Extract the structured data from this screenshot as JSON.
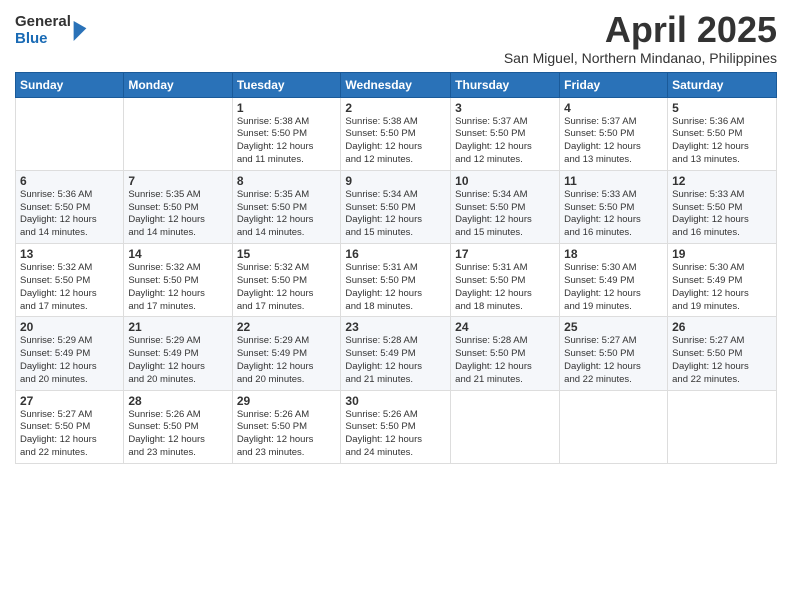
{
  "logo": {
    "general": "General",
    "blue": "Blue"
  },
  "title": "April 2025",
  "subtitle": "San Miguel, Northern Mindanao, Philippines",
  "weekdays": [
    "Sunday",
    "Monday",
    "Tuesday",
    "Wednesday",
    "Thursday",
    "Friday",
    "Saturday"
  ],
  "weeks": [
    [
      {
        "day": "",
        "info": ""
      },
      {
        "day": "",
        "info": ""
      },
      {
        "day": "1",
        "info": "Sunrise: 5:38 AM\nSunset: 5:50 PM\nDaylight: 12 hours\nand 11 minutes."
      },
      {
        "day": "2",
        "info": "Sunrise: 5:38 AM\nSunset: 5:50 PM\nDaylight: 12 hours\nand 12 minutes."
      },
      {
        "day": "3",
        "info": "Sunrise: 5:37 AM\nSunset: 5:50 PM\nDaylight: 12 hours\nand 12 minutes."
      },
      {
        "day": "4",
        "info": "Sunrise: 5:37 AM\nSunset: 5:50 PM\nDaylight: 12 hours\nand 13 minutes."
      },
      {
        "day": "5",
        "info": "Sunrise: 5:36 AM\nSunset: 5:50 PM\nDaylight: 12 hours\nand 13 minutes."
      }
    ],
    [
      {
        "day": "6",
        "info": "Sunrise: 5:36 AM\nSunset: 5:50 PM\nDaylight: 12 hours\nand 14 minutes."
      },
      {
        "day": "7",
        "info": "Sunrise: 5:35 AM\nSunset: 5:50 PM\nDaylight: 12 hours\nand 14 minutes."
      },
      {
        "day": "8",
        "info": "Sunrise: 5:35 AM\nSunset: 5:50 PM\nDaylight: 12 hours\nand 14 minutes."
      },
      {
        "day": "9",
        "info": "Sunrise: 5:34 AM\nSunset: 5:50 PM\nDaylight: 12 hours\nand 15 minutes."
      },
      {
        "day": "10",
        "info": "Sunrise: 5:34 AM\nSunset: 5:50 PM\nDaylight: 12 hours\nand 15 minutes."
      },
      {
        "day": "11",
        "info": "Sunrise: 5:33 AM\nSunset: 5:50 PM\nDaylight: 12 hours\nand 16 minutes."
      },
      {
        "day": "12",
        "info": "Sunrise: 5:33 AM\nSunset: 5:50 PM\nDaylight: 12 hours\nand 16 minutes."
      }
    ],
    [
      {
        "day": "13",
        "info": "Sunrise: 5:32 AM\nSunset: 5:50 PM\nDaylight: 12 hours\nand 17 minutes."
      },
      {
        "day": "14",
        "info": "Sunrise: 5:32 AM\nSunset: 5:50 PM\nDaylight: 12 hours\nand 17 minutes."
      },
      {
        "day": "15",
        "info": "Sunrise: 5:32 AM\nSunset: 5:50 PM\nDaylight: 12 hours\nand 17 minutes."
      },
      {
        "day": "16",
        "info": "Sunrise: 5:31 AM\nSunset: 5:50 PM\nDaylight: 12 hours\nand 18 minutes."
      },
      {
        "day": "17",
        "info": "Sunrise: 5:31 AM\nSunset: 5:50 PM\nDaylight: 12 hours\nand 18 minutes."
      },
      {
        "day": "18",
        "info": "Sunrise: 5:30 AM\nSunset: 5:49 PM\nDaylight: 12 hours\nand 19 minutes."
      },
      {
        "day": "19",
        "info": "Sunrise: 5:30 AM\nSunset: 5:49 PM\nDaylight: 12 hours\nand 19 minutes."
      }
    ],
    [
      {
        "day": "20",
        "info": "Sunrise: 5:29 AM\nSunset: 5:49 PM\nDaylight: 12 hours\nand 20 minutes."
      },
      {
        "day": "21",
        "info": "Sunrise: 5:29 AM\nSunset: 5:49 PM\nDaylight: 12 hours\nand 20 minutes."
      },
      {
        "day": "22",
        "info": "Sunrise: 5:29 AM\nSunset: 5:49 PM\nDaylight: 12 hours\nand 20 minutes."
      },
      {
        "day": "23",
        "info": "Sunrise: 5:28 AM\nSunset: 5:49 PM\nDaylight: 12 hours\nand 21 minutes."
      },
      {
        "day": "24",
        "info": "Sunrise: 5:28 AM\nSunset: 5:50 PM\nDaylight: 12 hours\nand 21 minutes."
      },
      {
        "day": "25",
        "info": "Sunrise: 5:27 AM\nSunset: 5:50 PM\nDaylight: 12 hours\nand 22 minutes."
      },
      {
        "day": "26",
        "info": "Sunrise: 5:27 AM\nSunset: 5:50 PM\nDaylight: 12 hours\nand 22 minutes."
      }
    ],
    [
      {
        "day": "27",
        "info": "Sunrise: 5:27 AM\nSunset: 5:50 PM\nDaylight: 12 hours\nand 22 minutes."
      },
      {
        "day": "28",
        "info": "Sunrise: 5:26 AM\nSunset: 5:50 PM\nDaylight: 12 hours\nand 23 minutes."
      },
      {
        "day": "29",
        "info": "Sunrise: 5:26 AM\nSunset: 5:50 PM\nDaylight: 12 hours\nand 23 minutes."
      },
      {
        "day": "30",
        "info": "Sunrise: 5:26 AM\nSunset: 5:50 PM\nDaylight: 12 hours\nand 24 minutes."
      },
      {
        "day": "",
        "info": ""
      },
      {
        "day": "",
        "info": ""
      },
      {
        "day": "",
        "info": ""
      }
    ]
  ]
}
